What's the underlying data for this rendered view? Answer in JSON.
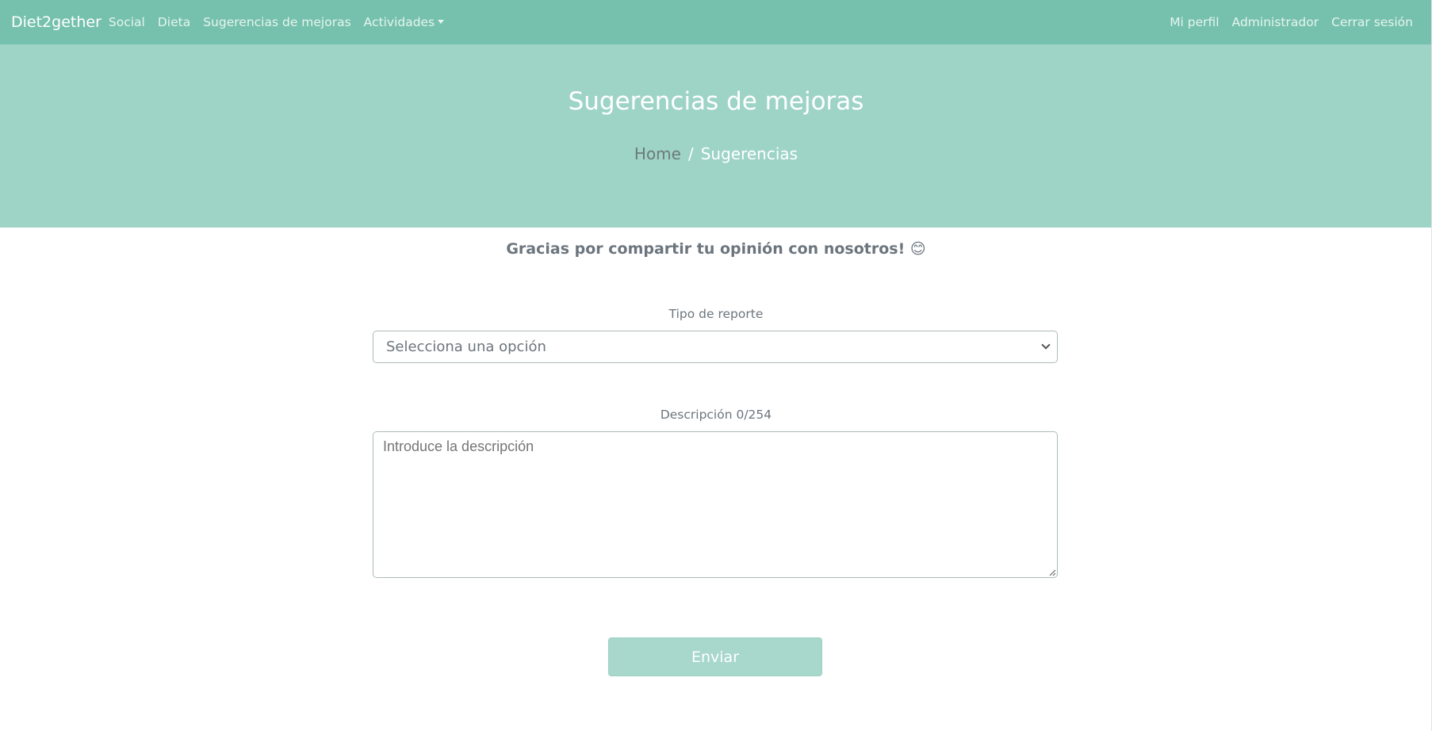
{
  "navbar": {
    "brand": "Diet2gether",
    "left_items": [
      "Social",
      "Dieta",
      "Sugerencias de mejoras",
      "Actividades"
    ],
    "right_items": [
      "Mi perfil",
      "Administrador",
      "Cerrar sesión"
    ]
  },
  "hero": {
    "title": "Sugerencias de mejoras",
    "breadcrumb": {
      "home": "Home",
      "separator": "/",
      "current": "Sugerencias"
    }
  },
  "form": {
    "thanks_text": "Gracias por compartir tu opinión con nosotros! 😊",
    "report_type": {
      "label": "Tipo de reporte",
      "selected": "Selecciona una opción"
    },
    "description": {
      "label": "Descripción 0/254",
      "placeholder": "Introduce la descripción",
      "value": ""
    },
    "submit_label": "Enviar"
  },
  "colors": {
    "navbar_bg": "#76c1ad",
    "hero_bg": "#9ed4c6",
    "button_bg": "#a8d8cb"
  }
}
